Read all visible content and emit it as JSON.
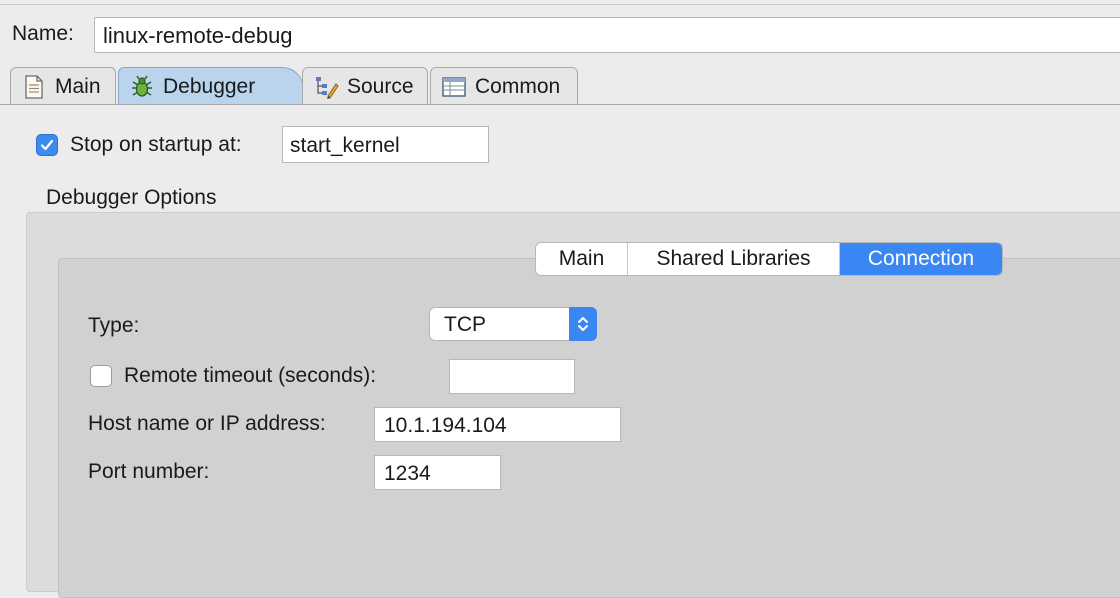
{
  "name": {
    "label": "Name:",
    "value": "linux-remote-debug"
  },
  "tabs": [
    {
      "label": "Main",
      "icon": "document-icon"
    },
    {
      "label": "Debugger",
      "icon": "bug-icon",
      "active": true
    },
    {
      "label": "Source",
      "icon": "source-tree-icon"
    },
    {
      "label": "Common",
      "icon": "table-icon"
    }
  ],
  "debugger": {
    "stop_on_startup": {
      "label": "Stop on startup at:",
      "checked": true,
      "value": "start_kernel"
    },
    "options_label": "Debugger Options",
    "subtabs": [
      {
        "label": "Main"
      },
      {
        "label": "Shared Libraries"
      },
      {
        "label": "Connection",
        "active": true
      }
    ],
    "connection": {
      "type_label": "Type:",
      "type_value": "TCP",
      "remote_timeout_label": "Remote timeout (seconds):",
      "remote_timeout_checked": false,
      "remote_timeout_value": "",
      "host_label": "Host name or IP address:",
      "host_value": "10.1.194.104",
      "port_label": "Port number:",
      "port_value": "1234"
    }
  },
  "colors": {
    "accent": "#3a86f2",
    "active_tab": "#b9d4ec"
  }
}
